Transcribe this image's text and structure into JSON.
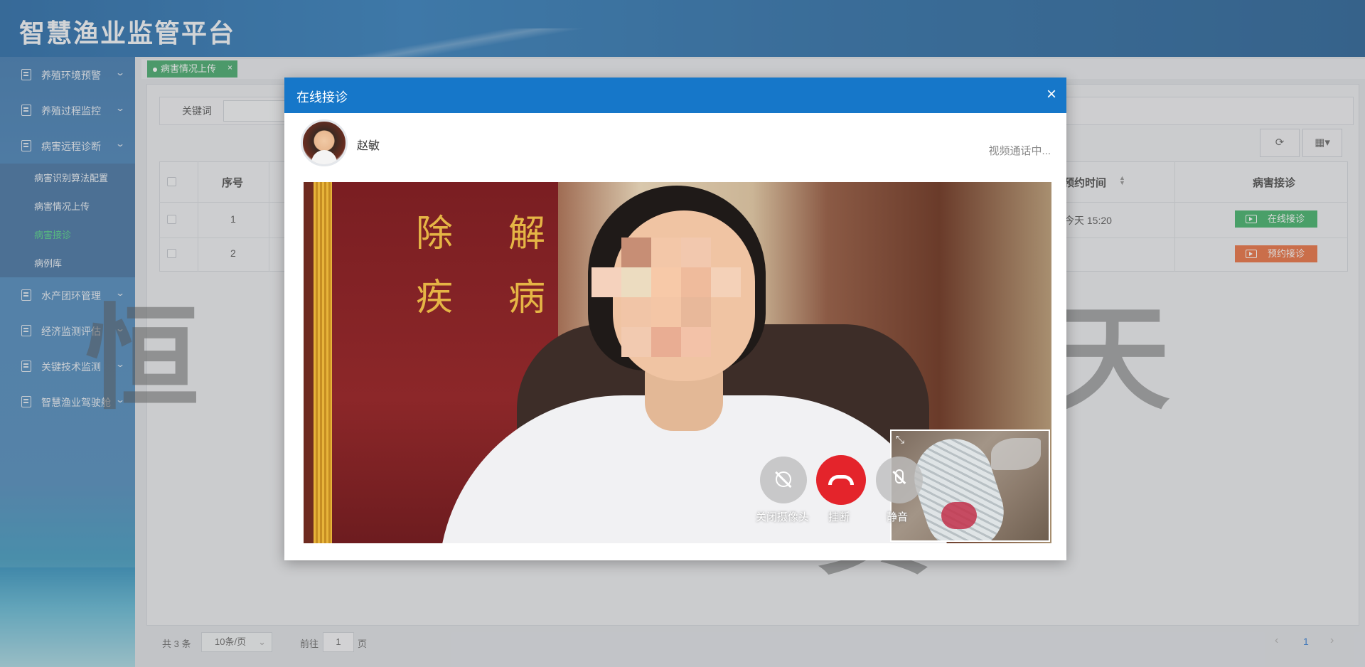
{
  "app": {
    "title": "智慧渔业监管平台"
  },
  "sidebar": {
    "items": [
      {
        "label": "养殖环境预警"
      },
      {
        "label": "养殖过程监控"
      },
      {
        "label": "病害远程诊断"
      },
      {
        "label": "水产团环管理"
      },
      {
        "label": "经济监测评估"
      },
      {
        "label": "关键技术监测"
      },
      {
        "label": "智慧渔业驾驶舱"
      }
    ],
    "submenu": [
      {
        "label": "病害识别算法配置"
      },
      {
        "label": "病害情况上传"
      },
      {
        "label": "病害接诊",
        "active": true
      },
      {
        "label": "病例库"
      }
    ]
  },
  "tabs": [
    {
      "label": "病害情况上传",
      "close": "×"
    }
  ],
  "search": {
    "keyword_label": "关键词"
  },
  "toolbar": {
    "refresh_icon": "refresh-icon",
    "columns_icon": "grid-icon"
  },
  "table": {
    "headers": {
      "index": "序号",
      "appoint_time": "预约时间",
      "action": "病害接诊"
    },
    "rows": [
      {
        "index": "1",
        "appoint_time": "今天 15:20",
        "action": "在线接诊",
        "action_color": "#2aa857"
      },
      {
        "index": "2",
        "appoint_time": "",
        "action": "预约接诊",
        "action_color": "#e8602c"
      }
    ]
  },
  "pagination": {
    "total": "共 3 条",
    "page_size": "10条/页",
    "goto_prefix": "前往",
    "goto_value": "1",
    "goto_suffix": "页",
    "current": "1",
    "prev": "‹",
    "next": "›"
  },
  "watermark": {
    "text": "恒 天 翼"
  },
  "modal": {
    "title": "在线接诊",
    "close": "×",
    "caller_name": "赵敏",
    "status": "视频通话中...",
    "controls": {
      "camera_off": "关闭摄像头",
      "hangup": "挂断",
      "mute": "静音"
    }
  },
  "colors": {
    "header": "#1a6fb5",
    "modal_header": "#1677c9",
    "hangup": "#e4242b",
    "active_menu": "#3fd07a"
  }
}
